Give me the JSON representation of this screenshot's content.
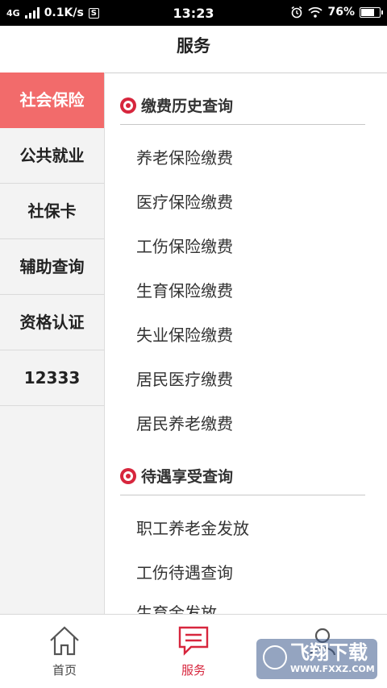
{
  "status_bar": {
    "network": "4G",
    "speed": "0.1K/s",
    "s_badge": "S",
    "time": "13:23",
    "battery": "76%",
    "battery_level": 0.76
  },
  "header": {
    "title": "服务"
  },
  "sidebar": {
    "items": [
      {
        "label": "社会保险",
        "active": true
      },
      {
        "label": "公共就业",
        "active": false
      },
      {
        "label": "社保卡",
        "active": false
      },
      {
        "label": "辅助查询",
        "active": false
      },
      {
        "label": "资格认证",
        "active": false
      },
      {
        "label": "12333",
        "active": false
      }
    ]
  },
  "content": {
    "sections": [
      {
        "title": "缴费历史查询",
        "items": [
          "养老保险缴费",
          "医疗保险缴费",
          "工伤保险缴费",
          "生育保险缴费",
          "失业保险缴费",
          "居民医疗缴费",
          "居民养老缴费"
        ]
      },
      {
        "title": "待遇享受查询",
        "items": [
          "职工养老金发放",
          "工伤待遇查询",
          "生育金发放"
        ]
      }
    ]
  },
  "bottom_nav": {
    "items": [
      {
        "label": "首页",
        "icon": "home-icon"
      },
      {
        "label": "服务",
        "icon": "message-icon",
        "active": true
      },
      {
        "label": "",
        "icon": "user-icon"
      }
    ]
  },
  "watermark": {
    "text": "飞翔下载",
    "url": "WWW.FXXZ.COM"
  },
  "colors": {
    "accent": "#d7263d",
    "sidebar_active": "#f26b6b"
  }
}
